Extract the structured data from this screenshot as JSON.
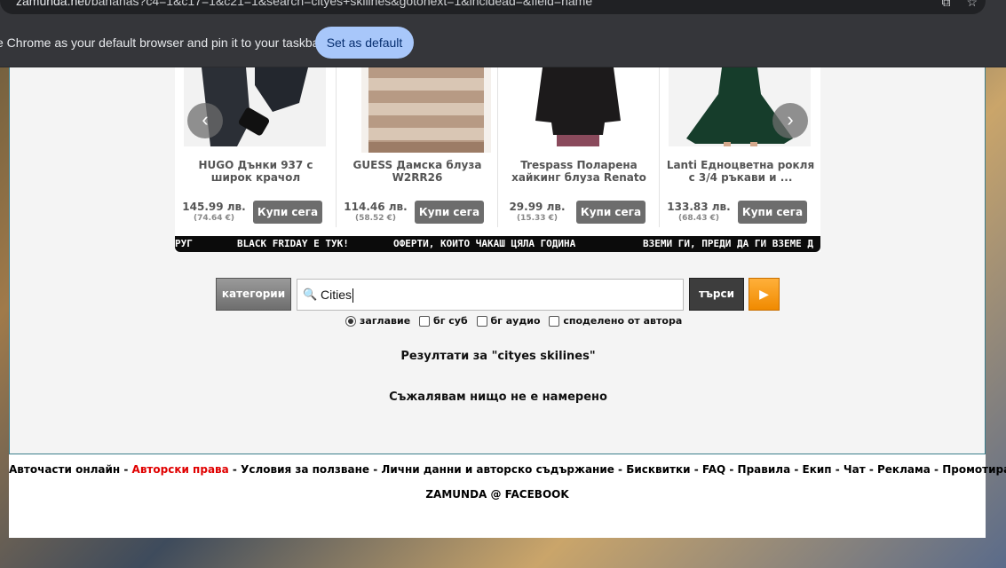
{
  "browser": {
    "url_host": "zamunda.net",
    "url_rest": "/bananas?c4=1&c17=1&c21=1&search=cityes+skilines&gotonext=1&incldead=&field=name",
    "infobar_message": "e Chrome as your default browser and pin it to your taskbar",
    "set_default_label": "Set as default"
  },
  "carousel": {
    "prev_label": "‹",
    "next_label": "›",
    "products": [
      {
        "name": "HUGO Дънки 937 с широк крачол",
        "price": "145.99 лв.",
        "price_eur": "(74.64 €)",
        "buy_label": "Купи сега"
      },
      {
        "name": "GUESS Дамска блуза W2RR26",
        "price": "114.46 лв.",
        "price_eur": "(58.52 €)",
        "buy_label": "Купи сега"
      },
      {
        "name": "Trespass Поларена хайкинг блуза Renato",
        "price": "29.99 лв.",
        "price_eur": "(15.33 €)",
        "buy_label": "Купи сега"
      },
      {
        "name": "Lanti Едноцветна рокля с 3/4 ръкави и ...",
        "price": "133.83 лв.",
        "price_eur": "(68.43 €)",
        "buy_label": "Купи сега"
      }
    ],
    "ticker": [
      "РУГ",
      "BLACK FRIDAY Е ТУК!",
      "ОФЕРТИ, КОИТО ЧАКАШ ЦЯЛА ГОДИНА",
      "ВЗЕМИ ГИ, ПРЕДИ ДА ГИ ВЗЕМЕ Д"
    ]
  },
  "search": {
    "categories_label": "категории",
    "query": "Cities",
    "search_label": "търси",
    "go_label": "▶",
    "options": [
      {
        "label": "заглавие",
        "type": "radio",
        "checked": true
      },
      {
        "label": "бг суб",
        "type": "checkbox",
        "checked": false
      },
      {
        "label": "бг аудио",
        "type": "checkbox",
        "checked": false
      },
      {
        "label": "споделено от автора",
        "type": "checkbox",
        "checked": false
      }
    ]
  },
  "results": {
    "title": "Резултати за \"cityes skilines\"",
    "none_message": "Съжалявам нищо не е намерено"
  },
  "footer": {
    "links": [
      "Авточасти онлайн",
      "Авторски права",
      "Условия за ползване",
      "Лични данни и авторско съдържание",
      "Бисквитки",
      "FAQ",
      "Правила",
      "Екип",
      "Чат",
      "Реклама",
      "Промотиране"
    ],
    "separator": " - ",
    "facebook": "ZAMUNDA @ FACEBOOK"
  },
  "colors": {
    "accent": "#f08a00",
    "link_red": "#e00000",
    "border": "#3b7e8c"
  }
}
